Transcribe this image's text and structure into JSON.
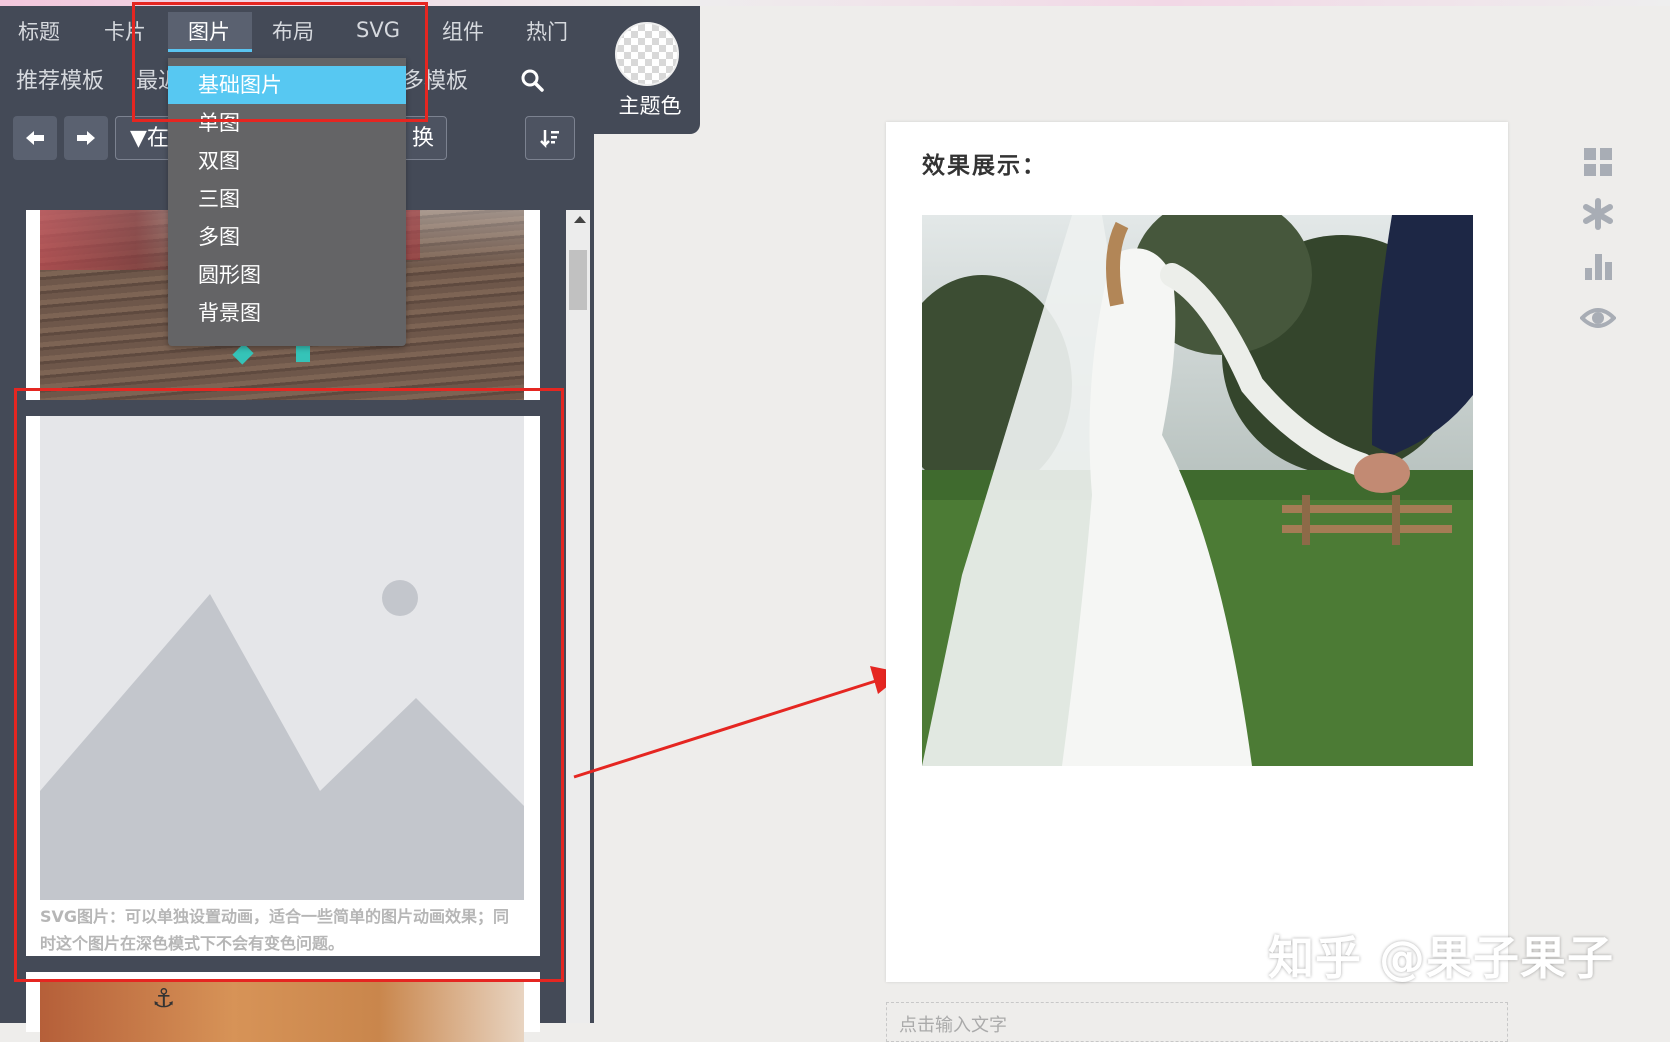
{
  "nav": {
    "tabs": [
      "标题",
      "卡片",
      "图片",
      "布局",
      "SVG",
      "组件",
      "热门"
    ],
    "row2": {
      "recommended": "推荐模板",
      "recent": "最近",
      "more": "多模板"
    },
    "undo_icon": "arrow-left-icon",
    "redo_icon": "arrow-right-icon",
    "filter_text": "在",
    "swap_text": "换",
    "search_icon": "search-icon",
    "sort_icon": "sort-icon"
  },
  "theme": {
    "label": "主题色"
  },
  "dropdown": {
    "items": [
      "基础图片",
      "单图",
      "双图",
      "三图",
      "多图",
      "圆形图",
      "背景图"
    ]
  },
  "list": {
    "caption": "SVG图片：可以单独设置动画，适合一些简单的图片动画效果；同时这个图片在深色模式下不会有变色问题。"
  },
  "canvas": {
    "title": "效果展示：",
    "input_placeholder": "点击输入文字"
  },
  "side_icons": [
    "grid-icon",
    "asterisk-icon",
    "bar-chart-icon",
    "eye-icon"
  ],
  "watermark": "知乎 @果子果子",
  "colors": {
    "accent": "#57c8f2",
    "annotation_red": "#e52621",
    "panel": "#444a57"
  }
}
